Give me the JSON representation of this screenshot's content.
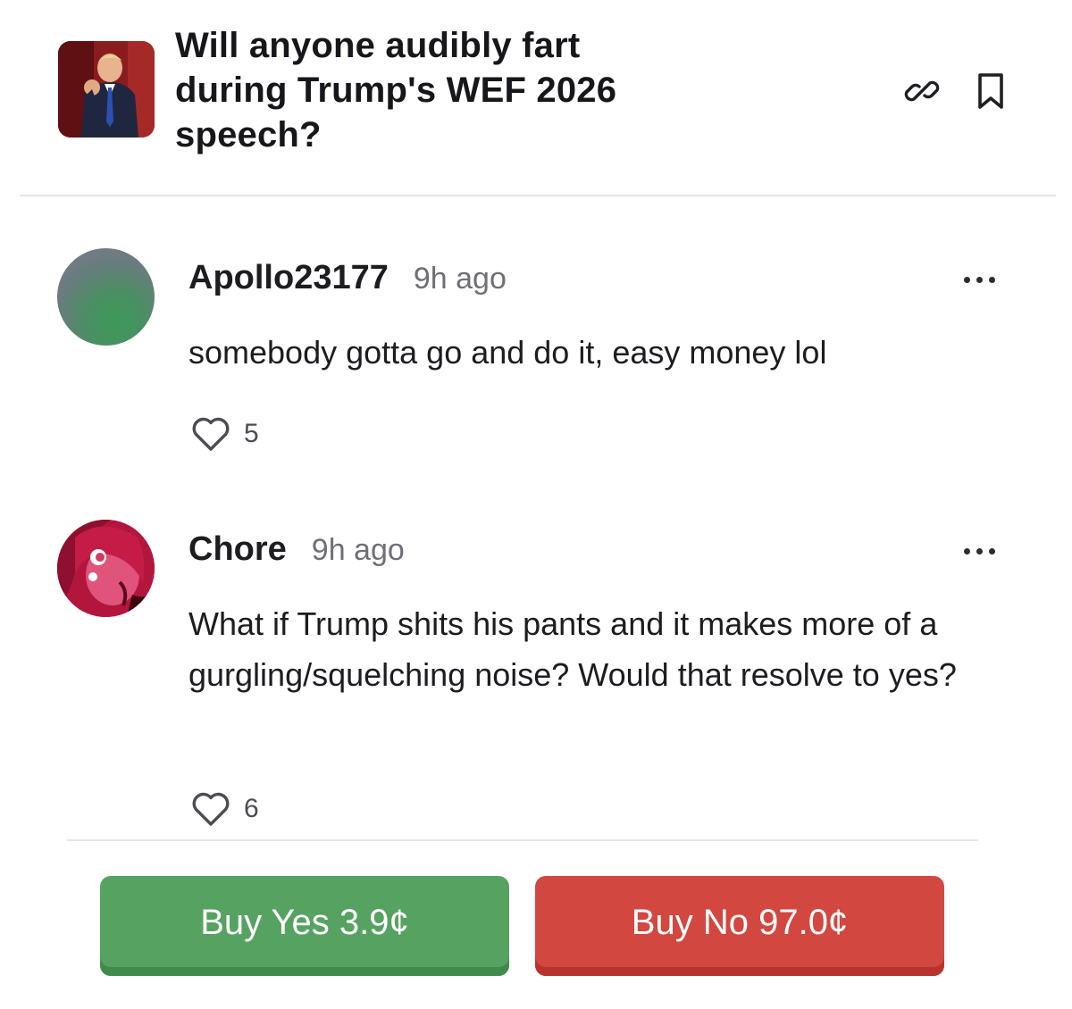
{
  "market": {
    "title": "Will anyone audibly fart during Trump's WEF 2026 speech?",
    "thumbnail_icon": "market-photo",
    "actions": {
      "link_icon": "link-icon",
      "bookmark_icon": "bookmark-icon"
    }
  },
  "comments": [
    {
      "username": "Apollo23177",
      "time": "9h ago",
      "text": "somebody gotta go and do it, easy money lol",
      "likes": "5",
      "avatar_icon": "gradient-avatar"
    },
    {
      "username": "Chore",
      "time": "9h ago",
      "text": "What if Trump shits his pants and it makes more of a gurgling/squelching noise? Would that resolve to yes?",
      "likes": "6",
      "avatar_icon": "anime-avatar"
    }
  ],
  "buy": {
    "yes_label": "Buy Yes 3.9¢",
    "no_label": "Buy No 97.0¢"
  },
  "colors": {
    "yes": "#56a261",
    "no": "#d2473f",
    "divider": "#e6e6e8",
    "muted_text": "#6f6f78"
  }
}
